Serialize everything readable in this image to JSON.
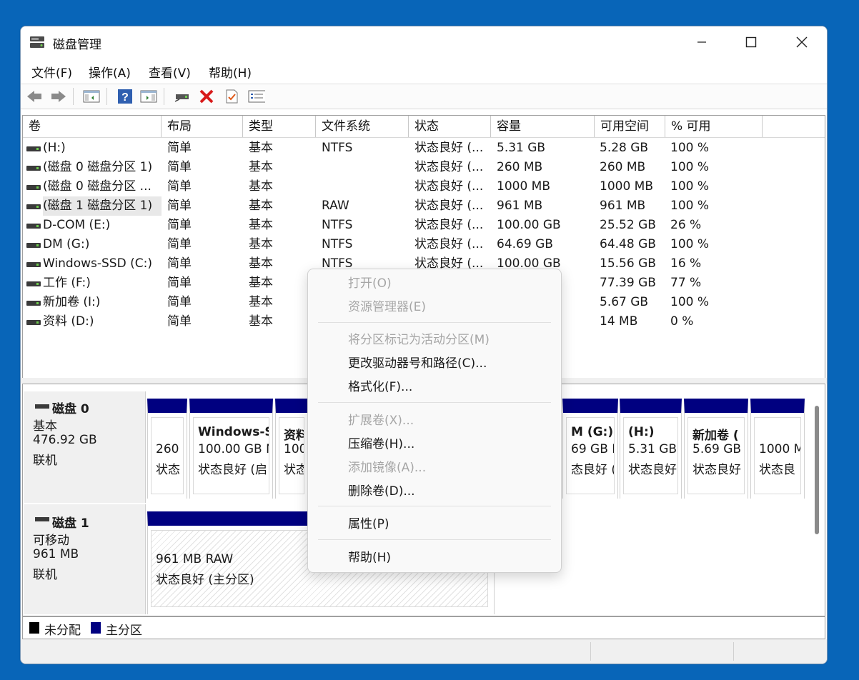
{
  "window": {
    "title": "磁盘管理"
  },
  "menu": [
    "文件(F)",
    "操作(A)",
    "查看(V)",
    "帮助(H)"
  ],
  "toolbar": [
    "back-icon",
    "forward-icon",
    "console-tree-icon",
    "help-icon",
    "action-pane-icon",
    "connect-drive-icon",
    "delete-icon",
    "checklist-icon",
    "properties-icon"
  ],
  "columns": [
    "卷",
    "布局",
    "类型",
    "文件系统",
    "状态",
    "容量",
    "可用空间",
    "% 可用"
  ],
  "volumes": [
    {
      "name": " (H:)",
      "layout": "简单",
      "type": "基本",
      "fs": "NTFS",
      "status": "状态良好 (...",
      "cap": "5.31 GB",
      "free": "5.28 GB",
      "pct": "100 %"
    },
    {
      "name": "(磁盘 0 磁盘分区 1)",
      "layout": "简单",
      "type": "基本",
      "fs": "",
      "status": "状态良好 (...",
      "cap": "260 MB",
      "free": "260 MB",
      "pct": "100 %"
    },
    {
      "name": "(磁盘 0 磁盘分区 ...",
      "layout": "简单",
      "type": "基本",
      "fs": "",
      "status": "状态良好 (...",
      "cap": "1000 MB",
      "free": "1000 MB",
      "pct": "100 %"
    },
    {
      "name": "(磁盘 1 磁盘分区 1)",
      "layout": "简单",
      "type": "基本",
      "fs": "RAW",
      "status": "状态良好 (...",
      "cap": "961 MB",
      "free": "961 MB",
      "pct": "100 %"
    },
    {
      "name": "D-COM (E:)",
      "layout": "简单",
      "type": "基本",
      "fs": "NTFS",
      "status": "状态良好 (...",
      "cap": "100.00 GB",
      "free": "25.52 GB",
      "pct": "26 %"
    },
    {
      "name": "DM (G:)",
      "layout": "简单",
      "type": "基本",
      "fs": "NTFS",
      "status": "状态良好 (...",
      "cap": "64.69 GB",
      "free": "64.48 GB",
      "pct": "100 %"
    },
    {
      "name": "Windows-SSD (C:)",
      "layout": "简单",
      "type": "基本",
      "fs": "NTFS",
      "status": "状态良好 (...",
      "cap": "100.00 GB",
      "free": "15.56 GB",
      "pct": "16 %"
    },
    {
      "name": "工作 (F:)",
      "layout": "简单",
      "type": "基本",
      "fs": "",
      "status": "",
      "cap": "",
      "free": "77.39 GB",
      "pct": "77 %"
    },
    {
      "name": "新加卷 (I:)",
      "layout": "简单",
      "type": "基本",
      "fs": "",
      "status": "",
      "cap": "",
      "free": "5.67 GB",
      "pct": "100 %"
    },
    {
      "name": "资料 (D:)",
      "layout": "简单",
      "type": "基本",
      "fs": "",
      "status": "",
      "cap": "",
      "free": "14 MB",
      "pct": "0 %"
    }
  ],
  "disk0": {
    "title": "磁盘 0",
    "type": "基本",
    "size": "476.92 GB",
    "state": "联机",
    "parts": [
      {
        "l1": "",
        "l2": "260",
        "l3": "状态"
      },
      {
        "l1": "Windows-S",
        "l2": "100.00 GB N",
        "l3": "状态良好 (启"
      },
      {
        "l1": "资料",
        "l2": "100.",
        "l3": "状态"
      },
      {
        "l1": "M (G:)",
        "l2": "69 GB N",
        "l3": "态良好 (基"
      },
      {
        "l1": "(H:)",
        "l2": "5.31 GB",
        "l3": "状态良好"
      },
      {
        "l1": "新加卷 (",
        "l2": "5.69 GB",
        "l3": "状态良好"
      },
      {
        "l1": "",
        "l2": "1000 M",
        "l3": "状态良"
      }
    ]
  },
  "disk1": {
    "title": "磁盘 1",
    "type": "可移动",
    "size": "961 MB",
    "state": "联机",
    "part": {
      "l1": "961 MB RAW",
      "l2": "状态良好 (主分区)"
    }
  },
  "legend": [
    "未分配",
    "主分区"
  ],
  "context_menu": [
    {
      "label": "打开(O)",
      "enabled": false
    },
    {
      "label": "资源管理器(E)",
      "enabled": false
    },
    {
      "label": "将分区标记为活动分区(M)",
      "enabled": false
    },
    {
      "label": "更改驱动器号和路径(C)...",
      "enabled": true
    },
    {
      "label": "格式化(F)...",
      "enabled": true
    },
    {
      "label": "扩展卷(X)...",
      "enabled": false
    },
    {
      "label": "压缩卷(H)...",
      "enabled": true
    },
    {
      "label": "添加镜像(A)...",
      "enabled": false
    },
    {
      "label": "删除卷(D)...",
      "enabled": true
    },
    {
      "label": "属性(P)",
      "enabled": true
    },
    {
      "label": "帮助(H)",
      "enabled": true
    }
  ],
  "colors": {
    "primary_partition": "#000080",
    "unallocated": "#000000",
    "desktop": "#0865b8"
  }
}
